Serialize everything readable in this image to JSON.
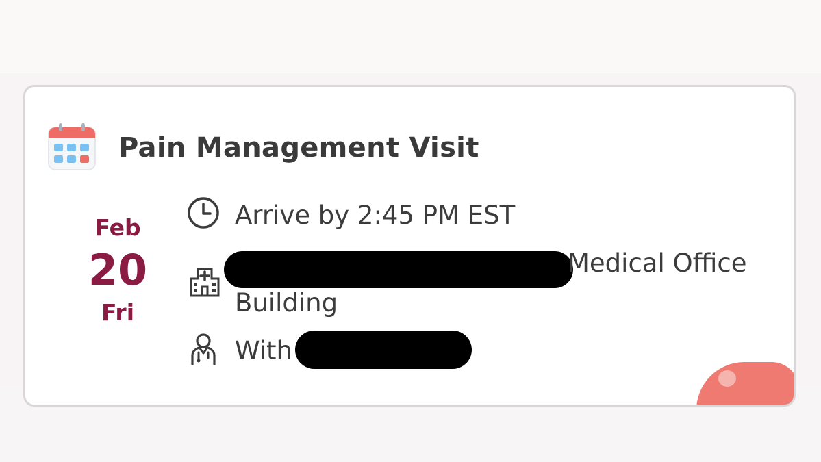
{
  "appointment": {
    "title": "Pain Management Visit",
    "date": {
      "month": "Feb",
      "day": "20",
      "weekday": "Fri"
    },
    "arrival": "Arrive by 2:45 PM EST",
    "location": {
      "line1_suffix": "Medical Office",
      "line2": "Building"
    },
    "provider_prefix": "With"
  },
  "icons": {
    "header": "calendar-icon",
    "arrival": "clock-icon",
    "location": "hospital-icon",
    "provider": "doctor-icon"
  },
  "colors": {
    "date_accent": "#8a1c43",
    "text": "#3d3c3c",
    "card_border": "#d9d6d7",
    "calendar_header": "#ef6b66",
    "calendar_tiles": "#78c1f2"
  }
}
